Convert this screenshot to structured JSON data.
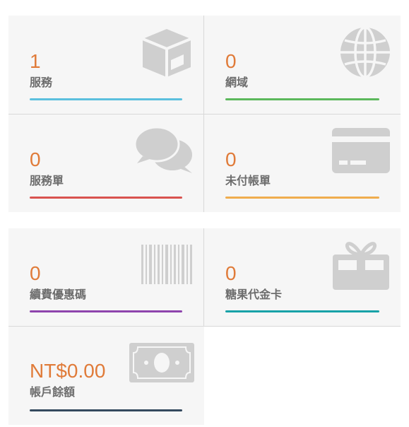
{
  "tiles": {
    "services": {
      "count": "1",
      "label": "服務",
      "accent": "#5bc0de",
      "icon": "cube-icon"
    },
    "domains": {
      "count": "0",
      "label": "網域",
      "accent": "#5cb85c",
      "icon": "globe-icon"
    },
    "tickets": {
      "count": "0",
      "label": "服務單",
      "accent": "#d9534f",
      "icon": "chat-bubbles-icon"
    },
    "unpaid_invoices": {
      "count": "0",
      "label": "未付帳單",
      "accent": "#f0ad4e",
      "icon": "credit-card-icon"
    },
    "renewal_coupons": {
      "count": "0",
      "label": "續費優惠碼",
      "accent": "#8e44ad",
      "icon": "barcode-icon"
    },
    "gift_cards": {
      "count": "0",
      "label": "糖果代金卡",
      "accent": "#17a2a8",
      "icon": "gift-icon"
    },
    "account_balance": {
      "count": "NT$0.00",
      "label": "帳戶餘額",
      "accent": "#34495e",
      "icon": "banknote-icon"
    }
  }
}
